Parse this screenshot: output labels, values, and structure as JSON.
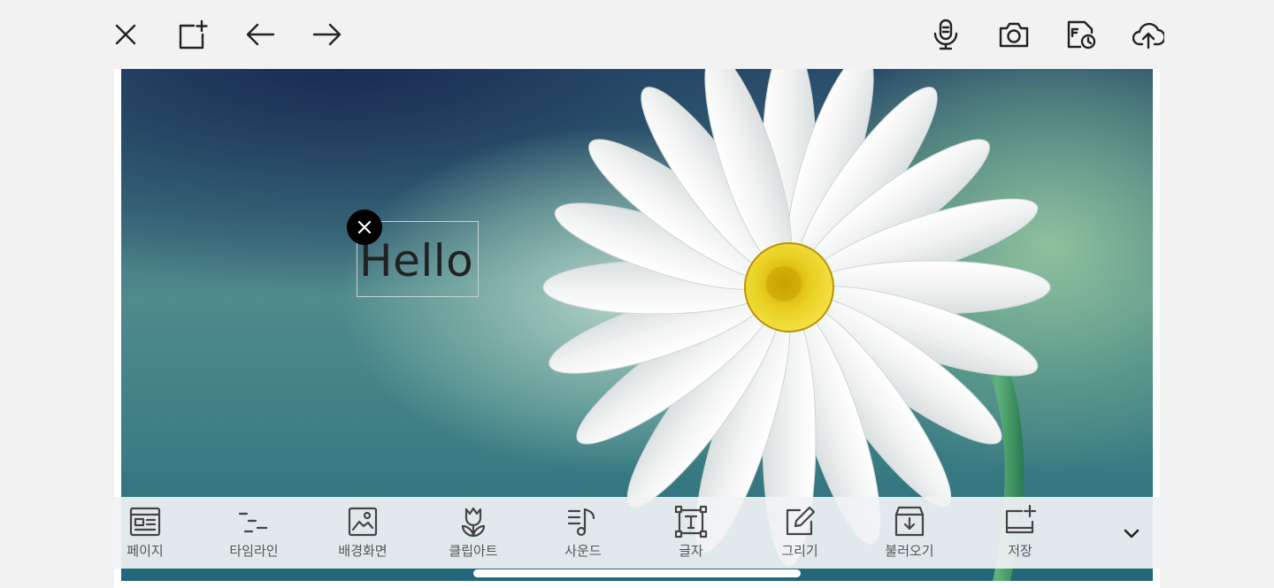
{
  "top_toolbar": {
    "left_icons": [
      "close-icon",
      "new-page-icon",
      "undo-icon",
      "redo-icon"
    ],
    "right_icons": [
      "microphone-icon",
      "camera-icon",
      "history-file-icon",
      "cloud-upload-icon"
    ]
  },
  "canvas": {
    "background": "daisy-photo",
    "text_object": {
      "text": "Hello",
      "color": "#222222"
    }
  },
  "bottom_toolbar": {
    "items": [
      {
        "label": "페이지",
        "icon": "page-layout-icon"
      },
      {
        "label": "타임라인",
        "icon": "timeline-icon"
      },
      {
        "label": "배경화면",
        "icon": "background-image-icon"
      },
      {
        "label": "클립아트",
        "icon": "clipart-tulip-icon"
      },
      {
        "label": "사운드",
        "icon": "sound-icon"
      },
      {
        "label": "글자",
        "icon": "text-icon"
      },
      {
        "label": "그리기",
        "icon": "draw-icon"
      },
      {
        "label": "불러오기",
        "icon": "import-icon"
      },
      {
        "label": "저장",
        "icon": "save-page-icon"
      }
    ],
    "collapse_icon": "chevron-down-icon"
  },
  "colors": {
    "page_bg": "#f2f2f2",
    "toolbar_bg": "#f0f2f4",
    "icon_dark": "#222222",
    "label_gray": "#555555"
  }
}
